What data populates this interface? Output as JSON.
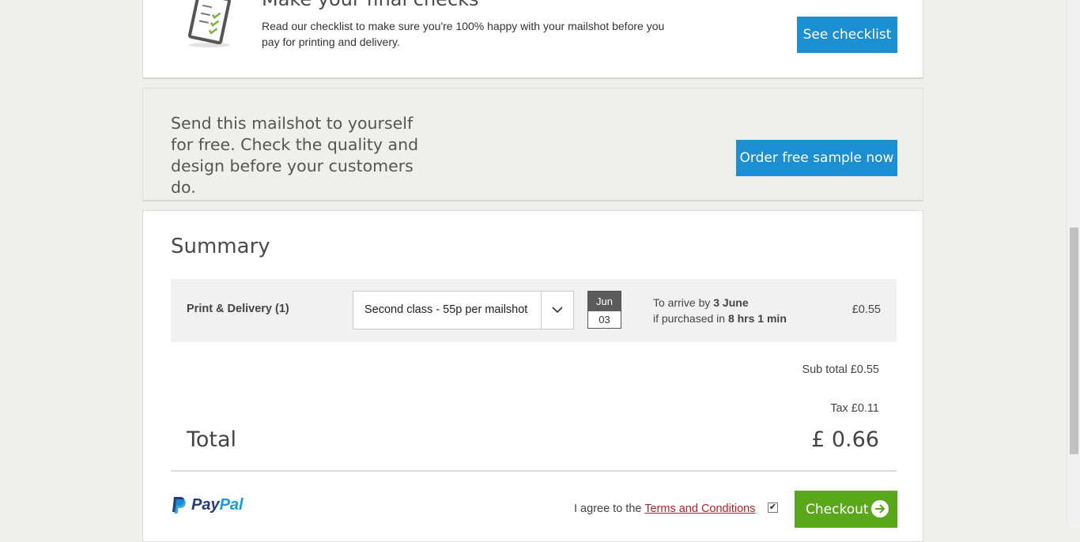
{
  "checks": {
    "title": "Make your final checks",
    "description": "Read our checklist to make sure you're 100% happy with your mailshot before you pay for printing and delivery.",
    "button": "See checklist",
    "icon": "checklist-clipboard-icon"
  },
  "sample": {
    "text": "Send this mailshot to yourself for free. Check the quality and design before your customers do.",
    "button": "Order free sample now"
  },
  "summary": {
    "title": "Summary",
    "line": {
      "label": "Print & Delivery (1)",
      "option": "Second class - 55p per mailshot",
      "cal_month": "Jun",
      "cal_day": "03",
      "arrive_prefix": "To arrive by ",
      "arrive_date": "3 June",
      "purchase_prefix": "if purchased in ",
      "purchase_time": "8 hrs 1 min",
      "price": "£0.55"
    },
    "subtotal": "Sub total £0.55",
    "tax": "Tax £0.11",
    "total_label": "Total",
    "total_value": "£ 0.66"
  },
  "checkout": {
    "paypal_pay": "Pay",
    "paypal_pal": "Pal",
    "agree_prefix": "I agree to the ",
    "terms_link": "Terms and Conditions",
    "checked": true,
    "button": "Checkout"
  },
  "colors": {
    "accent_blue": "#1b8fd2",
    "checkout_green": "#5ba71b",
    "terms_red": "#b2232b",
    "background": "#efefeb"
  }
}
